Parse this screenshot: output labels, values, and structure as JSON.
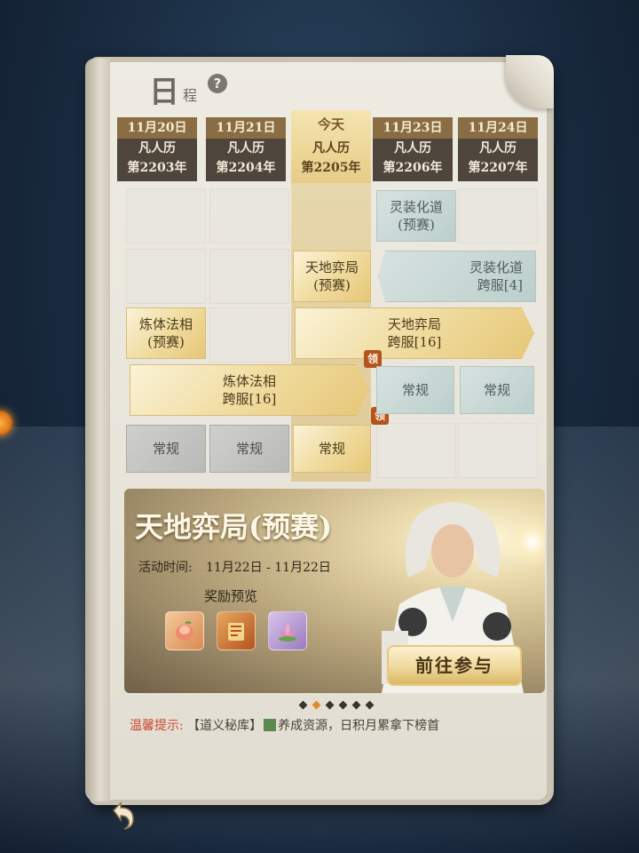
{
  "header": {
    "title_main": "日",
    "title_sub": "程",
    "help_glyph": "?"
  },
  "dates": [
    {
      "date": "11月20日",
      "cal": "凡人历",
      "year": "第2203年"
    },
    {
      "date": "11月21日",
      "cal": "凡人历",
      "year": "第2204年"
    },
    {
      "date": "今天",
      "cal": "凡人历",
      "year": "第2205年",
      "today": true
    },
    {
      "date": "11月23日",
      "cal": "凡人历",
      "year": "第2206年"
    },
    {
      "date": "11月24日",
      "cal": "凡人历",
      "year": "第2207年"
    }
  ],
  "events": {
    "lingzhuang_pre": [
      "灵装化道",
      "(预赛)"
    ],
    "tiandi_pre": [
      "天地弈局",
      "(预赛)"
    ],
    "lingzhuang_cross": [
      "灵装化道",
      "跨服[4]"
    ],
    "lianti_pre": [
      "炼体法相",
      "(预赛)"
    ],
    "tiandi_cross": [
      "天地弈局",
      "跨服[16]"
    ],
    "lianti_cross": [
      "炼体法相",
      "跨服[16]"
    ],
    "normal": "常规",
    "claim": "领"
  },
  "banner": {
    "title": "天地弈局(预赛)",
    "time_label": "活动时间:",
    "time_value": "11月22日 - 11月22日",
    "reward_label": "奖励预览",
    "go_button": "前往参与"
  },
  "pager": {
    "count": 6,
    "active_index": 1
  },
  "tip": {
    "label": "温馨提示:",
    "bracket": "【道义秘库】",
    "text": "养成资源，日积月累拿下榜首"
  },
  "colors": {
    "gold": "#f0dca0",
    "teal": "#bccfcc",
    "grey": "#b9b9b7",
    "claim": "#b4531d",
    "accent": "#e48a2c"
  },
  "icons": {
    "help": "question-icon",
    "back": "back-arrow-icon",
    "rewards": [
      "peach-reward-icon",
      "scroll-reward-icon",
      "lotus-reward-icon"
    ]
  }
}
